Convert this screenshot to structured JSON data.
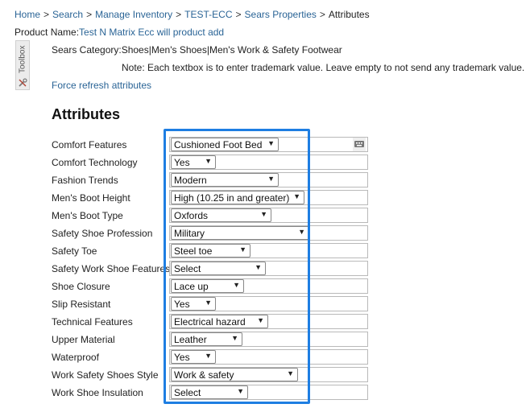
{
  "breadcrumb": {
    "items": [
      "Home",
      "Search",
      "Manage Inventory",
      "TEST-ECC",
      "Sears Properties"
    ],
    "current": "Attributes",
    "separator": ">"
  },
  "product": {
    "label": "Product Name:",
    "name": "Test N Matrix Ecc will product add"
  },
  "toolbox": {
    "label": "Toolbox",
    "icon": "wrench-screwdriver-icon"
  },
  "category": {
    "text": "Sears Category:Shoes|Men's Shoes|Men's Work & Safety Footwear"
  },
  "note": {
    "text": "Note: Each textbox is to enter trademark value. Leave empty to not send any trademark value."
  },
  "refresh": {
    "label": "Force refresh attributes"
  },
  "section": {
    "title": "Attributes"
  },
  "attributes": [
    {
      "label": "Comfort Features",
      "value": "Cushioned Foot Bed"
    },
    {
      "label": "Comfort Technology",
      "value": "Yes"
    },
    {
      "label": "Fashion Trends",
      "value": "Modern"
    },
    {
      "label": "Men's Boot Height",
      "value": "High (10.25 in and greater)"
    },
    {
      "label": "Men's Boot Type",
      "value": "Oxfords"
    },
    {
      "label": "Safety Shoe Profession",
      "value": "Military"
    },
    {
      "label": "Safety Toe",
      "value": "Steel toe"
    },
    {
      "label": "Safety Work Shoe Features",
      "value": "Select"
    },
    {
      "label": "Shoe Closure",
      "value": "Lace up"
    },
    {
      "label": "Slip Resistant",
      "value": "Yes"
    },
    {
      "label": "Technical Features",
      "value": "Electrical hazard"
    },
    {
      "label": "Upper Material",
      "value": "Leather"
    },
    {
      "label": "Waterproof",
      "value": "Yes"
    },
    {
      "label": "Work Safety Shoes Style",
      "value": "Work & safety"
    },
    {
      "label": "Work Shoe Insulation",
      "value": "Select"
    }
  ],
  "colors": {
    "link": "#2a6496",
    "highlight": "#1e7ee2"
  }
}
